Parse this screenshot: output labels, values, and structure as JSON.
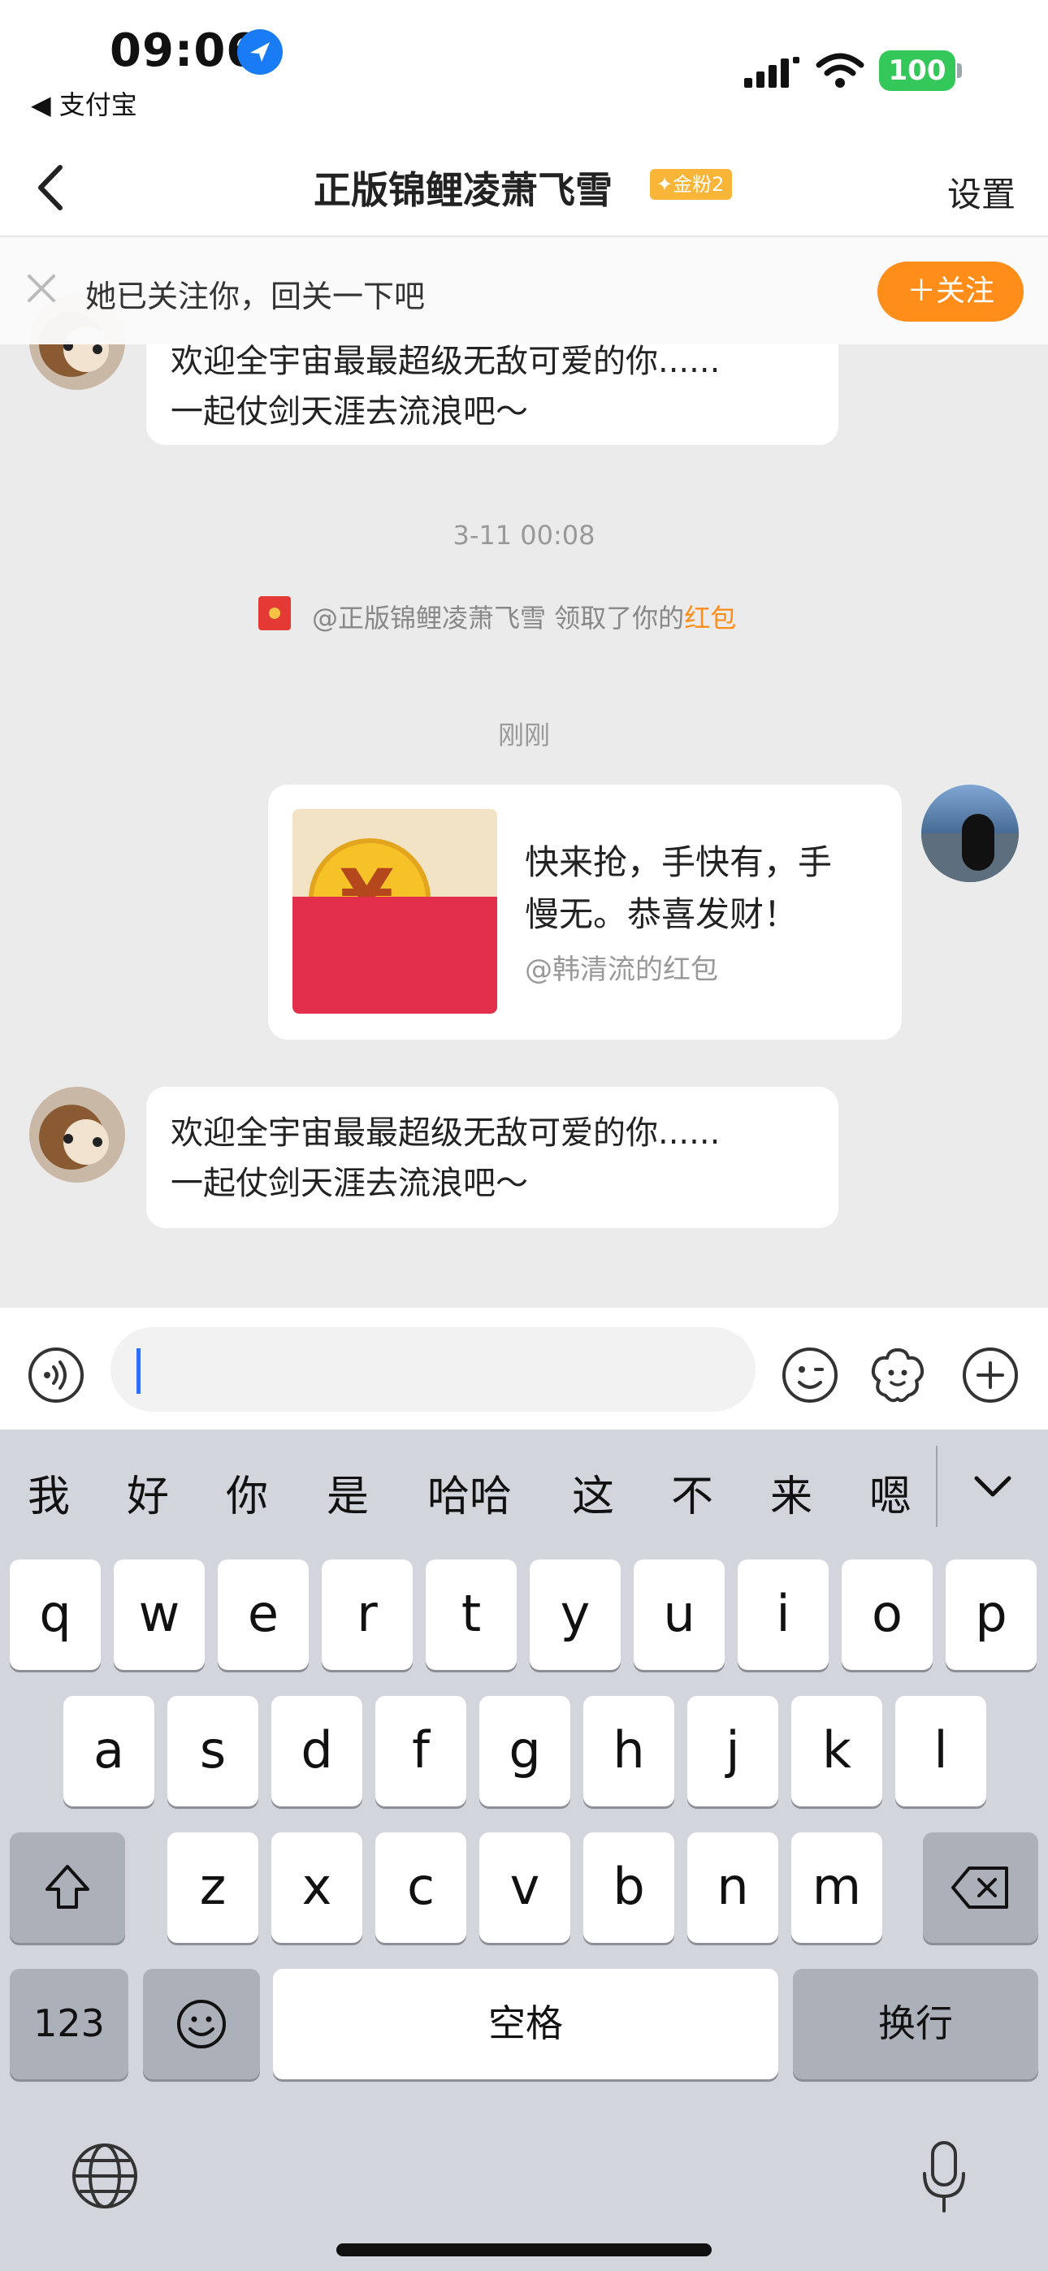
{
  "status_bar": {
    "time": "09:06",
    "back_app": "◀ 支付宝",
    "battery": "100"
  },
  "header": {
    "title": "正版锦鲤凌萧飞雪",
    "badge": "金粉2",
    "settings": "设置"
  },
  "follow_banner": {
    "text": "她已关注你，回关一下吧",
    "follow_button": "＋关注"
  },
  "chat": {
    "msg_top": {
      "line1": "欢迎全宇宙最最超级无敌可爱的你......",
      "line2": "一起仗剑天涯去流浪吧～"
    },
    "time1": "3-11 00:08",
    "system_prefix": "@正版锦鲤凌萧飞雪 领取了你的",
    "system_link": "红包",
    "time2": "刚刚",
    "red_packet": {
      "line1": "快来抢，手快有，手",
      "line2": "慢无。恭喜发财！",
      "sender": "@韩清流的红包"
    },
    "msg_bottom": {
      "line1": "欢迎全宇宙最最超级无敌可爱的你......",
      "line2": "一起仗剑天涯去流浪吧～"
    }
  },
  "keyboard": {
    "suggestions": [
      "我",
      "好",
      "你",
      "是",
      "哈哈",
      "这",
      "不",
      "来",
      "嗯"
    ],
    "row1": [
      "q",
      "w",
      "e",
      "r",
      "t",
      "y",
      "u",
      "i",
      "o",
      "p"
    ],
    "row2": [
      "a",
      "s",
      "d",
      "f",
      "g",
      "h",
      "j",
      "k",
      "l"
    ],
    "row3": [
      "z",
      "x",
      "c",
      "v",
      "b",
      "n",
      "m"
    ],
    "num_key": "123",
    "space_key": "空格",
    "return_key": "换行"
  },
  "colors": {
    "accent_orange": "#ff8d1a",
    "battery_green": "#34c759",
    "red_packet": "#e2304c",
    "keyboard_bg": "#d2d5db"
  }
}
